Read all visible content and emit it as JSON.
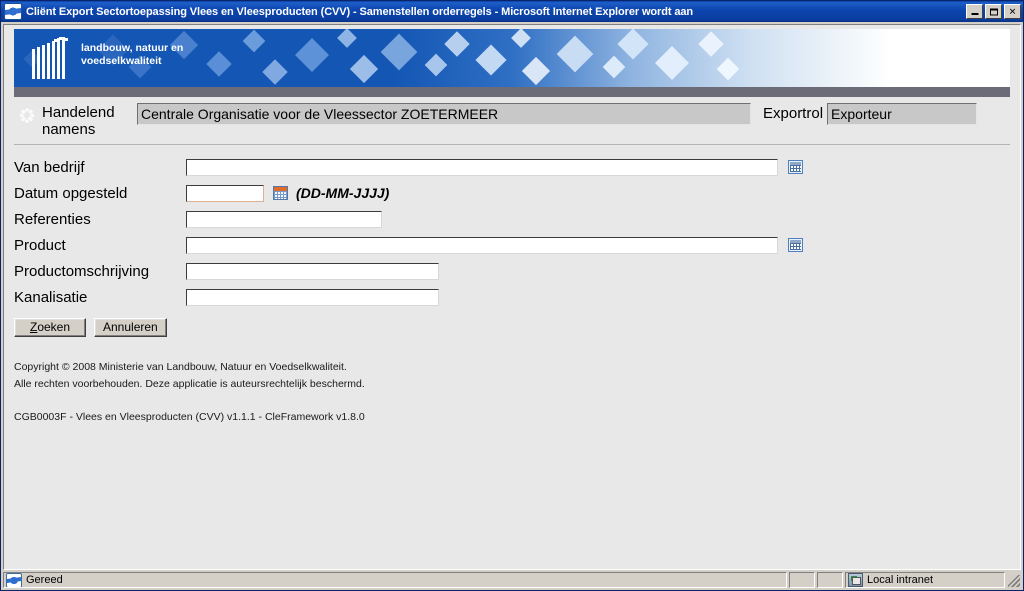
{
  "window": {
    "title": "Cliënt Export Sectortoepassing Vlees en Vleesproducten (CVV) - Samenstellen orderregels - Microsoft Internet Explorer wordt aan",
    "icon": "internet-explorer-icon",
    "minimize_label": "",
    "maximize_label": "",
    "close_label": "✕"
  },
  "banner": {
    "logo_line1": "landbouw, natuur en",
    "logo_line2": "voedselkwaliteit",
    "logo_alt": "ministry-logo"
  },
  "topbar": {
    "handelend_label": "Handelend namens",
    "handelend_value": "Centrale Organisatie voor de Vleessector ZOETERMEER",
    "exportrol_label": "Exportrol",
    "exportrol_value": "Exporteur",
    "star_icon": "asterisk-icon"
  },
  "form": {
    "fields": [
      {
        "label": "Van bedrijf",
        "value": "",
        "width": "w-long",
        "picker": "list-picker-icon"
      },
      {
        "label": "Datum opgesteld",
        "value": "",
        "width": "w-date",
        "calendar": "calendar-icon",
        "hint": "(DD-MM-JJJJ)"
      },
      {
        "label": "Referenties",
        "value": "",
        "width": "w-med"
      },
      {
        "label": "Product",
        "value": "",
        "width": "w-long",
        "picker": "list-picker-icon"
      },
      {
        "label": "Productomschrijving",
        "value": "",
        "width": "w-med2"
      },
      {
        "label": "Kanalisatie",
        "value": "",
        "width": "w-med2"
      }
    ],
    "buttons": {
      "search_accesskey": "Z",
      "search_rest": "oeken",
      "cancel": "Annuleren"
    }
  },
  "footer": {
    "copyright_line1": "Copyright © 2008 Ministerie van Landbouw, Natuur en Voedselkwaliteit.",
    "copyright_line2": "Alle rechten voorbehouden. Deze applicatie is auteursrechtelijk beschermd.",
    "version": "CGB0003F - Vlees en Vleesproducten (CVV) v1.1.1 - CleFramework v1.8.0"
  },
  "statusbar": {
    "status_text": "Gereed",
    "zone_text": "Local intranet",
    "status_icon": "internet-explorer-icon",
    "zone_icon": "security-zone-icon"
  },
  "colors": {
    "titlebar_blue": "#0d46b0",
    "banner_blue": "#1456b4",
    "grey_bar": "#6c6c78",
    "page_bg": "#e8e8e8",
    "readonly_field": "#c8c8c8"
  }
}
